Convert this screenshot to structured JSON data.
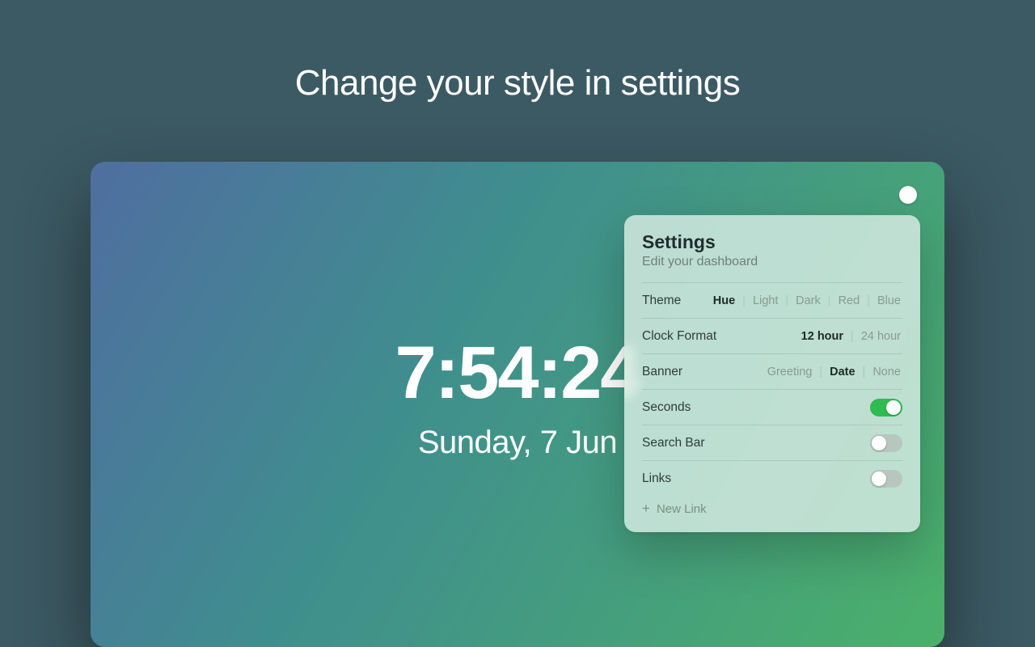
{
  "headline": "Change your style in settings",
  "clock": {
    "time": "7:54:24",
    "date": "Sunday, 7 Jun"
  },
  "panel": {
    "title": "Settings",
    "subtitle": "Edit your dashboard",
    "theme": {
      "label": "Theme",
      "options": [
        "Hue",
        "Light",
        "Dark",
        "Red",
        "Blue"
      ],
      "selected": "Hue"
    },
    "clockFormat": {
      "label": "Clock Format",
      "options": [
        "12 hour",
        "24 hour"
      ],
      "selected": "12 hour"
    },
    "banner": {
      "label": "Banner",
      "options": [
        "Greeting",
        "Date",
        "None"
      ],
      "selected": "Date"
    },
    "seconds": {
      "label": "Seconds",
      "on": true
    },
    "searchBar": {
      "label": "Search Bar",
      "on": false
    },
    "links": {
      "label": "Links",
      "on": false,
      "newLink": "New Link"
    }
  },
  "colors": {
    "toggleOn": "#2dbb52"
  }
}
